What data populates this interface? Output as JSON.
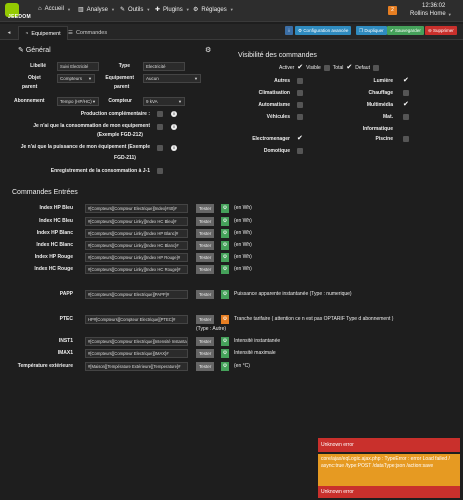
{
  "nav": {
    "logo": "JEEDOM",
    "items": [
      {
        "icon": "home-icon",
        "label": "Accueil"
      },
      {
        "icon": "chart-icon",
        "label": "Analyse"
      },
      {
        "icon": "wrench-icon",
        "label": "Outils"
      },
      {
        "icon": "puzzle-icon",
        "label": "Plugins"
      },
      {
        "icon": "gear-icon",
        "label": "Réglages"
      }
    ],
    "badge": "2",
    "time": "12:36:02",
    "home": "Rollins Home"
  },
  "tabs": {
    "back": "back-arrow-icon",
    "equipement": "Equipement",
    "commandes": "Commandes"
  },
  "actions": {
    "config": "Configuration avancée",
    "dupliquer": "Dupliquer",
    "sauvegarder": "Sauvegarder",
    "supprimer": "Supprimer"
  },
  "general": {
    "title": "Général",
    "libelle_label": "Libellé",
    "libelle_value": "Suivi Electricité",
    "type_label": "Type",
    "type_value": "Electricité",
    "objet_label": "Objet",
    "parent_label": "parent",
    "objet_value": "Compteurs",
    "equip_label": "Equipement",
    "equip_parent": "parent",
    "equip_value": "Aucun",
    "abo_label": "Abonnement",
    "abo_value": "Tempo (HP/HC)",
    "compteur_label": "Compteur",
    "compteur_value": "9 kVA",
    "prod_label": "Production complémentaire :",
    "conso_label": "Je n'ai que la consommation de mon equipement",
    "conso_sub": "(Exemple FGD-212)",
    "puiss_label": "Je n'ai que la puissance de mon équipement (Exemple",
    "puiss_sub": "FGD-211)",
    "enreg_label": "Enregistrement de la consommation à J-1"
  },
  "visibilite": {
    "title": "Visibilité des commandes",
    "activer": "Activer",
    "visible": "Visible",
    "total": "Total",
    "defaut": "Defaut",
    "left": [
      {
        "label": "Autres",
        "checked": false
      },
      {
        "label": "Climatisation",
        "checked": false
      },
      {
        "label": "Automatisme",
        "checked": false
      },
      {
        "label": "Véhicules",
        "checked": false
      },
      {
        "label": "Electromenager",
        "checked": true
      },
      {
        "label": "Domotique",
        "checked": false
      }
    ],
    "right": [
      {
        "label": "Lumière",
        "checked": true
      },
      {
        "label": "Chauffage",
        "checked": false
      },
      {
        "label": "Multimédia",
        "checked": true
      },
      {
        "label": "Mat.",
        "checked": false
      },
      {
        "label": "Informatique",
        "checked": null
      },
      {
        "label": "Piscine",
        "checked": false
      }
    ]
  },
  "commandes": {
    "title": "Commandes Entrées",
    "tester": "Tester",
    "rows": [
      {
        "label": "Index HP Bleu",
        "value": "#[Compteurs][Compteur Electrique][Index]#40]#",
        "unit": "(en Wh)",
        "gear": "green"
      },
      {
        "label": "Index HC Bleu",
        "value": "#[Compteurs][Compteur Linky][Index HC Bleu]#",
        "unit": "(en Wh)",
        "gear": "green"
      },
      {
        "label": "Index HP Blanc",
        "value": "#[Compteurs][Compteur Linky][Index HP Blanc]#",
        "unit": "(en Wh)",
        "gear": "green"
      },
      {
        "label": "Index HC Blanc",
        "value": "#[Compteurs][Compteur Linky][Index HC Blanc]#",
        "unit": "(en Wh)",
        "gear": "green"
      },
      {
        "label": "Index HP Rouge",
        "value": "#[Compteurs][Compteur Linky][Index HP Rouge]#",
        "unit": "(en Wh)",
        "gear": "green"
      },
      {
        "label": "Index HC Rouge",
        "value": "#[Compteurs][Compteur Linky][Index HC Rouge]#",
        "unit": "(en Wh)",
        "gear": "green"
      }
    ],
    "papp": {
      "label": "PAPP",
      "value": "#[Compteurs][Compteur Electrique][PAPP]#",
      "unit": "Puissance apparente instantanée (Type : numerique)"
    },
    "ptec": {
      "label": "PTEC",
      "value": "HP#[Compteurs][Compteur Electrique][PTEC]#",
      "unit": "Tranche tarifaire ( attention ce n est pas OPTARIF Type d abonnement )",
      "unit2": "(Type : Autre)"
    },
    "inst1": {
      "label": "INST1",
      "value": "#[Compteurs][Compteur Electrique][Intensité Instantanée]#",
      "unit": "Intensité instantanée"
    },
    "imax1": {
      "label": "IMAX1",
      "value": "#[Compteurs][Compteur Electrique][IMAX]#",
      "unit": "Intensité maximale"
    },
    "temp": {
      "label": "Température extérieure",
      "value": "#[Maison][Température Extérieure][Temperature]#",
      "unit": "(en °C)"
    }
  },
  "toasts": {
    "t1": "Unknown error",
    "t2": "core/ajax/eqLogic.ajax.php : TypeError : error Load failed / async:true /type:POST /dataType:json /action:save",
    "t3": "Unknown error"
  }
}
